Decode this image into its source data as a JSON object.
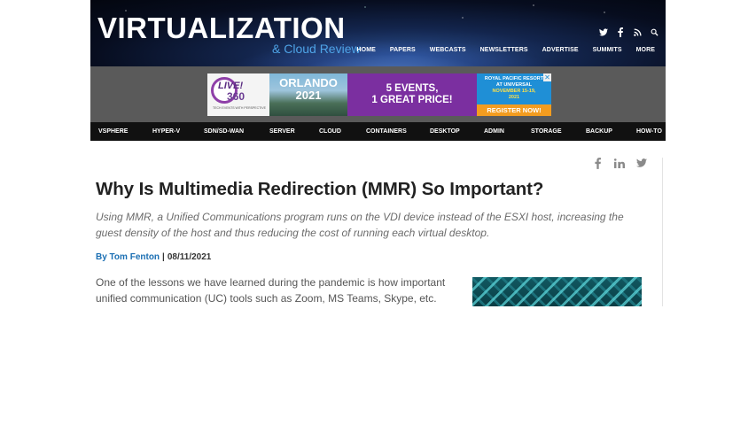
{
  "colors": {
    "accent_blue": "#1b6fb3",
    "logo_sub": "#4ea3e6",
    "nav_bg": "#111111",
    "ad_band_bg": "#5a5a5a"
  },
  "header": {
    "logo_text": "VIRTUALIZATION",
    "logo_sub": "& Cloud Review",
    "icons": [
      "twitter-icon",
      "facebook-icon",
      "rss-icon",
      "search-icon"
    ],
    "nav": [
      "HOME",
      "PAPERS",
      "WEBCASTS",
      "NEWSLETTERS",
      "ADVERTISE",
      "SUMMITS",
      "MORE"
    ]
  },
  "ad": {
    "live": "LIVE!",
    "num": "360",
    "tagline": "TECH EVENTS WITH PERSPECTIVE",
    "city": "ORLANDO",
    "year": "2021",
    "events_line1": "5 EVENTS,",
    "events_line2": "1 GREAT PRICE!",
    "resort_line1": "ROYAL PACIFIC RESORT",
    "resort_line2": "AT UNIVERSAL",
    "dates_line1": "NOVEMBER 15-19,",
    "dates_line2": "2021",
    "cta": "REGISTER NOW!"
  },
  "categories": [
    "VSPHERE",
    "HYPER-V",
    "SDN/SD-WAN",
    "SERVER",
    "CLOUD",
    "CONTAINERS",
    "DESKTOP",
    "ADMIN",
    "STORAGE",
    "BACKUP",
    "HOW-TO"
  ],
  "article": {
    "share_icons": [
      "facebook-icon",
      "linkedin-icon",
      "twitter-icon"
    ],
    "title": "Why Is Multimedia Redirection (MMR) So Important?",
    "subtitle": "Using MMR, a Unified Communications program runs on the VDI device instead of the ESXI host, increasing the guest density of the host and thus reducing the cost of running each virtual desktop.",
    "author": "By Tom Fenton",
    "separator": "|",
    "date": "08/11/2021",
    "body_line1": "One of the lessons we have learned during the pandemic is how important",
    "body_line2": "unified communication (UC) tools such as Zoom, MS Teams, Skype, etc."
  }
}
